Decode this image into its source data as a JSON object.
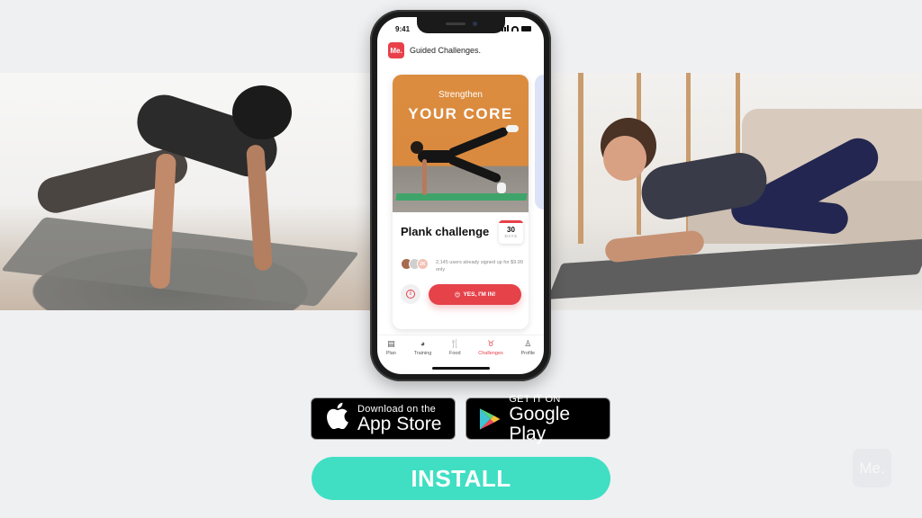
{
  "phone": {
    "status_time": "9:41",
    "app_logo": "Me.",
    "app_title": "Guided Challenges.",
    "card": {
      "image_subtitle": "Strengthen",
      "image_title": "YOUR CORE",
      "title": "Plank challenge",
      "days_number": "30",
      "days_label": "DAYS",
      "avatar_badge": "2K",
      "signup_text": "2,145 users already signed up for $9.99 only",
      "info_icon": "i",
      "cta_emoji": "😍",
      "cta_label": "YES, I'M IN!"
    },
    "tabs": [
      {
        "label": "Plan",
        "icon": "calendar-icon",
        "glyph": "▤",
        "active": false
      },
      {
        "label": "Training",
        "icon": "training-icon",
        "glyph": "◕",
        "active": false
      },
      {
        "label": "Food",
        "icon": "cutlery-icon",
        "glyph": "🍴",
        "active": false
      },
      {
        "label": "Challenges",
        "icon": "challenges-icon",
        "glyph": "♉",
        "active": true
      },
      {
        "label": "Profile",
        "icon": "profile-icon",
        "glyph": "♙",
        "active": false
      }
    ]
  },
  "stores": {
    "appstore_small": "Download on the",
    "appstore_big": "App Store",
    "gplay_small": "GET IT ON",
    "gplay_big": "Google Play"
  },
  "install_label": "INSTALL",
  "watermark": "Me.",
  "colors": {
    "accent_red": "#e5424a",
    "install_teal": "#40dfc3",
    "card_orange": "#dc8c3e"
  }
}
